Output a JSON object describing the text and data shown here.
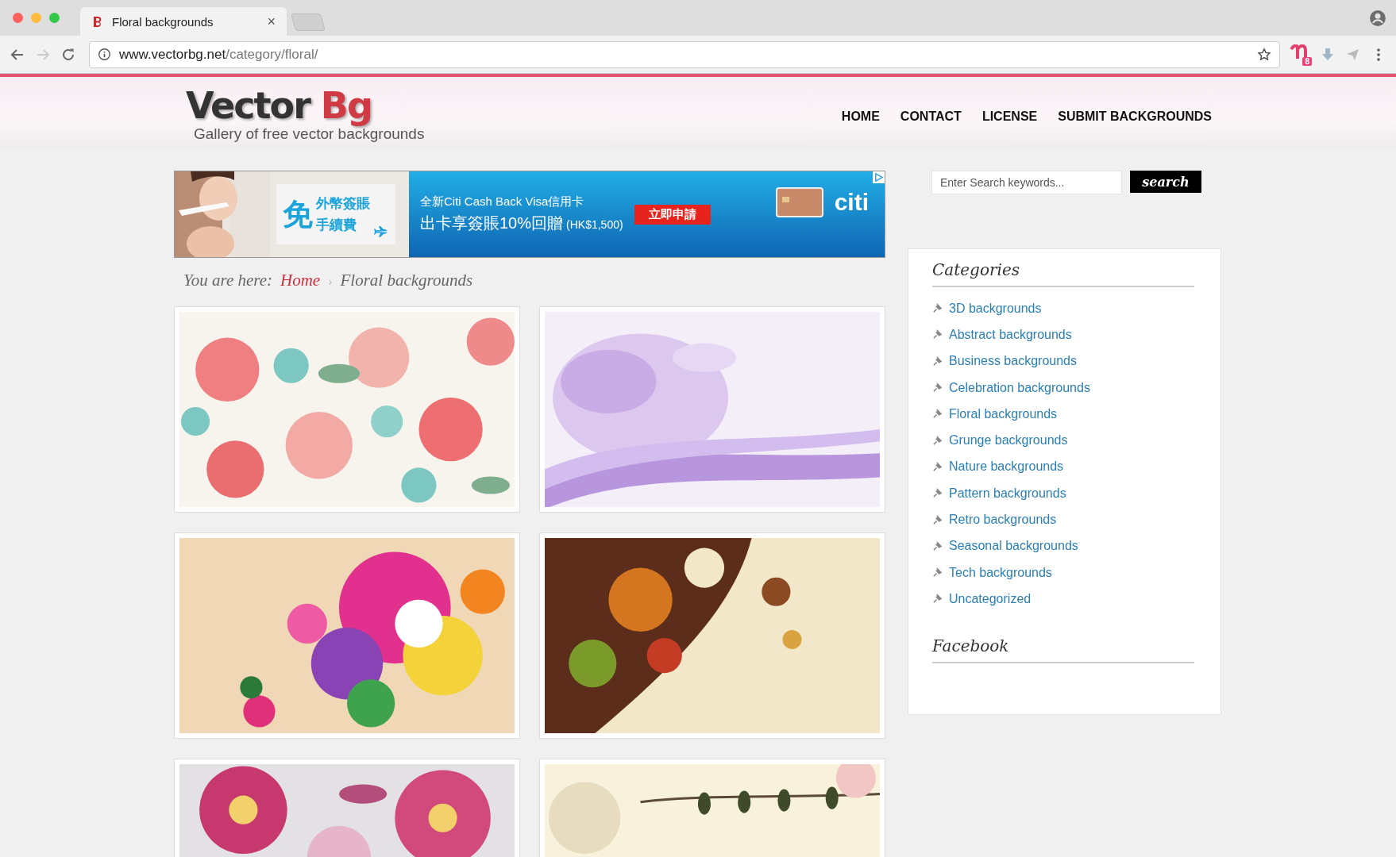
{
  "browser": {
    "tab": {
      "title": "Floral backgrounds",
      "close": "×"
    },
    "url": {
      "host": "www.vectorbg.net",
      "path": "/category/floral/"
    },
    "extension_badge": "8"
  },
  "header": {
    "logo": {
      "first": "Vector",
      "second": "Bg",
      "tagline": "Gallery of free vector backgrounds"
    },
    "nav": [
      {
        "label": "HOME"
      },
      {
        "label": "CONTACT"
      },
      {
        "label": "LICENSE"
      },
      {
        "label": "SUBMIT BACKGROUNDS"
      }
    ]
  },
  "ad": {
    "badge_left": {
      "big": "免",
      "line1": "外幣簽賬",
      "line2": "手續費"
    },
    "headline": "全新Citi Cash Back Visa信用卡",
    "offer": "出卡享簽賬10%回贈",
    "offer_note": "(HK$1,500)",
    "cta": "立即申請",
    "brand": "citi"
  },
  "breadcrumb": {
    "label": "You are here:",
    "home": "Home",
    "separator": "›",
    "current": "Floral backgrounds"
  },
  "search": {
    "placeholder": "Enter Search keywords...",
    "button": "search"
  },
  "sidebar": {
    "categories_title": "Categories",
    "categories": [
      {
        "label": "3D backgrounds"
      },
      {
        "label": "Abstract backgrounds"
      },
      {
        "label": "Business backgrounds"
      },
      {
        "label": "Celebration backgrounds"
      },
      {
        "label": "Floral backgrounds"
      },
      {
        "label": "Grunge backgrounds"
      },
      {
        "label": "Nature backgrounds"
      },
      {
        "label": "Pattern backgrounds"
      },
      {
        "label": "Retro backgrounds"
      },
      {
        "label": "Seasonal backgrounds"
      },
      {
        "label": "Tech backgrounds"
      },
      {
        "label": "Uncategorized"
      }
    ],
    "facebook_title": "Facebook"
  }
}
